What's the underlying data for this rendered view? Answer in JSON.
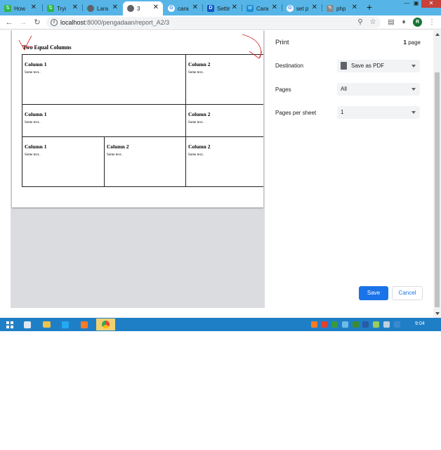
{
  "browser": {
    "tabs": [
      {
        "label": "How",
        "icon": "laravel-icon"
      },
      {
        "label": "Tryi",
        "icon": "laravel-icon"
      },
      {
        "label": "Lara",
        "icon": "globe-icon"
      },
      {
        "label": "3",
        "icon": "globe-icon",
        "active": true
      },
      {
        "label": "cara",
        "icon": "google-icon"
      },
      {
        "label": "Settir",
        "icon": "d-icon"
      },
      {
        "label": "Cara",
        "icon": "web-icon"
      },
      {
        "label": "set p",
        "icon": "google-icon"
      },
      {
        "label": "php",
        "icon": "pen-icon"
      }
    ],
    "new_tab": "+",
    "url_host": "localhost",
    "url_path": ":8000/pengadaan/report_A2/3",
    "profile_initial": "R"
  },
  "document": {
    "title": "Two Equal Columns",
    "rows": [
      [
        {
          "title": "Column 1",
          "text": "Some text.."
        },
        {
          "title": "Column 2",
          "text": "Some text.."
        }
      ],
      [
        {
          "title": "Column 1",
          "text": "Some text.."
        },
        {
          "title": "Column 2",
          "text": "Some text.."
        }
      ],
      [
        {
          "title": "Column 1",
          "text": "Some text.."
        },
        {
          "title": "Column 2",
          "text": "Some text.."
        },
        {
          "title": "Column 2",
          "text": "Some text.."
        }
      ]
    ]
  },
  "print_panel": {
    "title": "Print",
    "page_count": "1",
    "page_word": "page",
    "destination_label": "Destination",
    "destination_value": "Save as PDF",
    "pages_label": "Pages",
    "pages_value": "All",
    "pages_per_sheet_label": "Pages per sheet",
    "pages_per_sheet_value": "1",
    "save_label": "Save",
    "cancel_label": "Cancel"
  },
  "taskbar": {
    "clock": "9:04"
  },
  "colors": {
    "tab_strip": "#56b5e6",
    "accent": "#1a73e8",
    "taskbar": "#1f7fc6",
    "scribble": "#d62020"
  }
}
